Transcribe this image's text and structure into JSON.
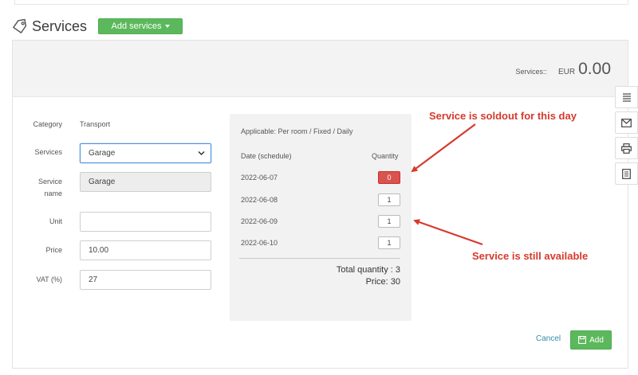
{
  "header": {
    "title": "Services",
    "add_services_label": "Add services"
  },
  "summary": {
    "label": "Services::",
    "currency": "EUR",
    "amount": "0.00"
  },
  "side_tools": [
    "list-icon",
    "envelope-icon",
    "printer-icon",
    "document-icon"
  ],
  "form": {
    "category_label": "Category",
    "category_value": "Transport",
    "services_label": "Services",
    "services_selected": "Garage",
    "service_name_label_1": "Service",
    "service_name_label_2": "name",
    "service_name_value": "Garage",
    "unit_label": "Unit",
    "unit_value": "",
    "price_label": "Price",
    "price_value": "10.00",
    "vat_label": "VAT (%)",
    "vat_value": "27"
  },
  "schedule": {
    "applicable": "Applicable: Per room / Fixed / Daily",
    "date_header": "Date (schedule)",
    "quantity_header": "Quantity",
    "rows": [
      {
        "date": "2022-06-07",
        "quantity": "0"
      },
      {
        "date": "2022-06-08",
        "quantity": "1"
      },
      {
        "date": "2022-06-09",
        "quantity": "1"
      },
      {
        "date": "2022-06-10",
        "quantity": "1"
      }
    ],
    "total_quantity": "Total quantity : 3",
    "price_total": "Price:  30"
  },
  "annotations": {
    "soldout": "Service is soldout for this day",
    "available": "Service is still available"
  },
  "actions": {
    "cancel_label": "Cancel",
    "add_label": "Add"
  },
  "colors": {
    "green": "#5cb85c",
    "soldout_red": "#d9534f",
    "annotation_red": "#d63a2c",
    "link": "#2e8fa8"
  }
}
